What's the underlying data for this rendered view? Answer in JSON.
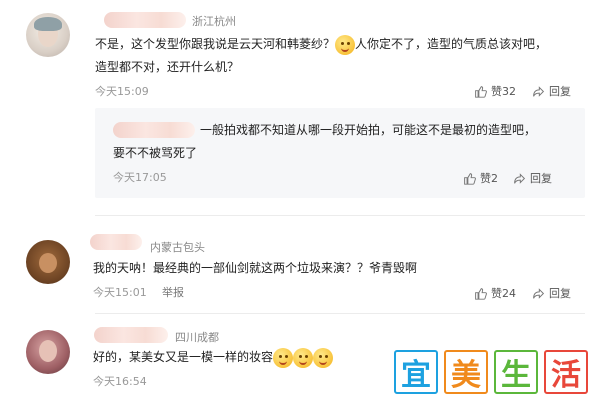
{
  "comments": [
    {
      "location": "浙江杭州",
      "text_a": "不是，这个发型你跟我说是云天河和韩菱纱？",
      "text_b": "人你定不了，造型的气质总该对吧，",
      "text_c": "造型都不对，还开什么机？",
      "time": "今天15:09",
      "like_icon": "thumbs-up-icon",
      "like_label": "赞32",
      "reply_icon": "share-arrow-icon",
      "reply_label": "回复",
      "reply": {
        "text_a": "一般拍戏都不知道从哪一段开始拍，可能这不是最初的造型吧，",
        "text_b": "要不不被骂死了",
        "time": "今天17:05",
        "like_label": "赞2",
        "reply_label": "回复"
      }
    },
    {
      "location": "内蒙古包头",
      "text": "我的天呐！最经典的一部仙剑就这两个垃圾来演？？爷青毁啊",
      "time": "今天15:01",
      "report": "举报",
      "like_label": "赞24",
      "reply_label": "回复"
    },
    {
      "location": "四川成都",
      "text": "好的，某美女又是一模一样的妆容",
      "time": "今天16:54"
    }
  ],
  "watermark": {
    "chars": [
      "宜",
      "美",
      "生",
      "活"
    ],
    "colors": [
      "#1da1e0",
      "#f08a1c",
      "#5bb73b",
      "#e8473a"
    ]
  }
}
